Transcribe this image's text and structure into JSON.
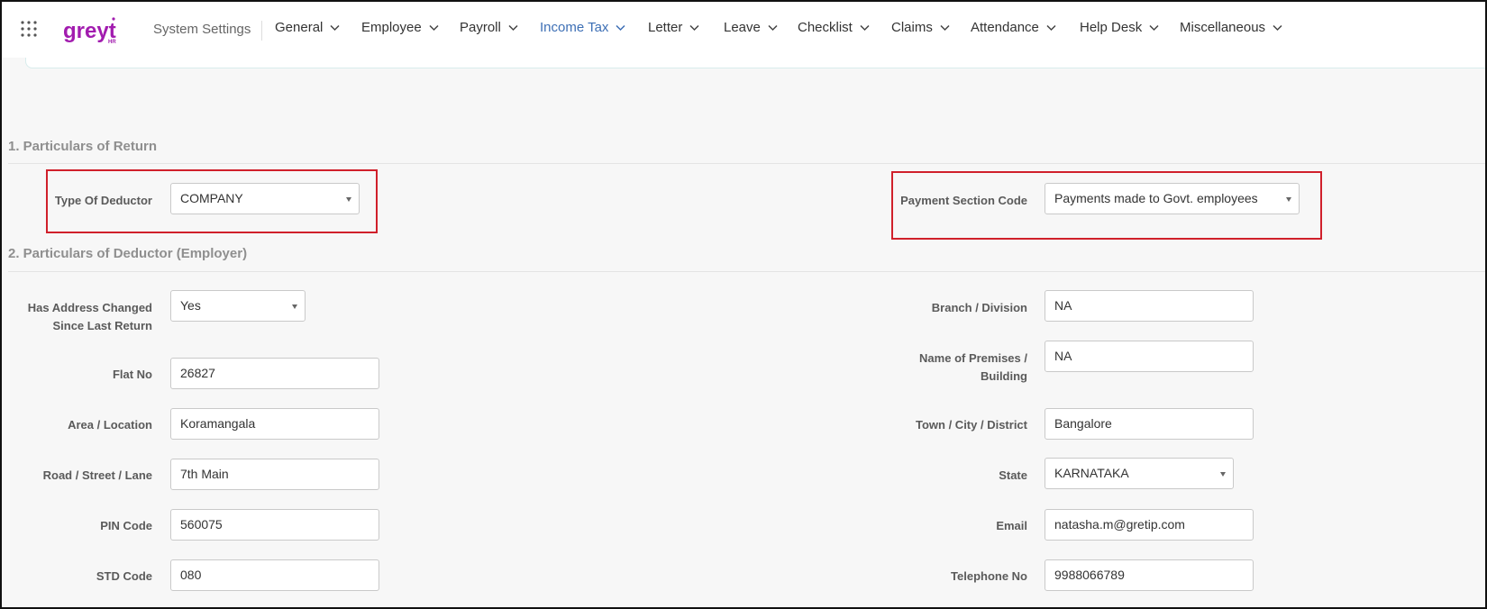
{
  "brand": {
    "logo_text": "greyt",
    "logo_sub": "HR",
    "logo_color": "#a21caf"
  },
  "nav": {
    "system_settings": "System Settings",
    "items": [
      {
        "label": "General"
      },
      {
        "label": "Employee"
      },
      {
        "label": "Payroll"
      },
      {
        "label": "Income Tax",
        "active": true
      },
      {
        "label": "Letter"
      },
      {
        "label": "Leave"
      },
      {
        "label": "Checklist"
      },
      {
        "label": "Claims"
      },
      {
        "label": "Attendance"
      },
      {
        "label": "Help Desk"
      },
      {
        "label": "Miscellaneous"
      }
    ],
    "active_color": "#3d6fb5"
  },
  "section1": {
    "title": "1. Particulars of Return",
    "type_of_deductor": {
      "label": "Type Of Deductor",
      "value": "COMPANY"
    },
    "payment_section_code": {
      "label": "Payment Section Code",
      "value": "Payments made to Govt. employees"
    }
  },
  "section2": {
    "title": "2. Particulars of Deductor (Employer)",
    "has_address_changed": {
      "label": "Has Address Changed Since Last Return",
      "value": "Yes"
    },
    "flat_no": {
      "label": "Flat No",
      "value": "26827"
    },
    "area_location": {
      "label": "Area / Location",
      "value": "Koramangala"
    },
    "road_street_lane": {
      "label": "Road / Street / Lane",
      "value": "7th Main"
    },
    "pin_code": {
      "label": "PIN Code",
      "value": "560075"
    },
    "std_code": {
      "label": "STD Code",
      "value": "080"
    },
    "branch_division": {
      "label": "Branch / Division",
      "value": "NA"
    },
    "name_of_premises": {
      "label": "Name of Premises / Building",
      "value": "NA"
    },
    "town_city_district": {
      "label": "Town / City / District",
      "value": "Bangalore"
    },
    "state": {
      "label": "State",
      "value": "KARNATAKA"
    },
    "email": {
      "label": "Email",
      "value": "natasha.m@gretip.com"
    },
    "telephone_no": {
      "label": "Telephone No",
      "value": "9988066789"
    }
  },
  "highlight_color": "#d0202b"
}
